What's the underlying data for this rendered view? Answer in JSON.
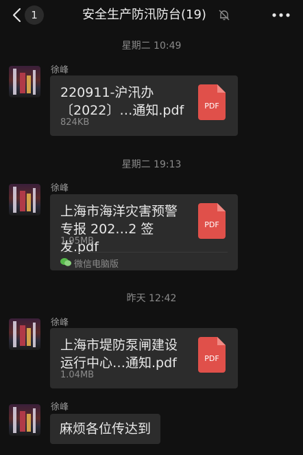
{
  "header": {
    "unread_count": "1",
    "title": "安全生产防汛防台(19)"
  },
  "messages": [
    {
      "time": "星期二 10:49",
      "sender": "徐峰",
      "file_name_line1": "220911-沪汛办",
      "file_name_line2": "〔2022〕…通知.pdf",
      "file_size": "824KB",
      "file_type": "PDF"
    },
    {
      "time": "星期二 19:13",
      "sender": "徐峰",
      "file_name_line1": "上海市海洋灾害预警",
      "file_name_line2": "专报 202…2 签发.pdf",
      "file_size": "1.95MB",
      "file_type": "PDF",
      "source": "微信电脑版"
    },
    {
      "time": "昨天 12:42",
      "sender": "徐峰",
      "file_name_line1": "上海市堤防泵闸建设",
      "file_name_line2": "运行中心…通知.pdf",
      "file_size": "1.04MB",
      "file_type": "PDF"
    },
    {
      "sender": "徐峰",
      "text": "麻烦各位传达到"
    }
  ],
  "colors": {
    "background": "#111111",
    "bubble": "#2c2c2c",
    "pdf_red": "#e0504a"
  }
}
